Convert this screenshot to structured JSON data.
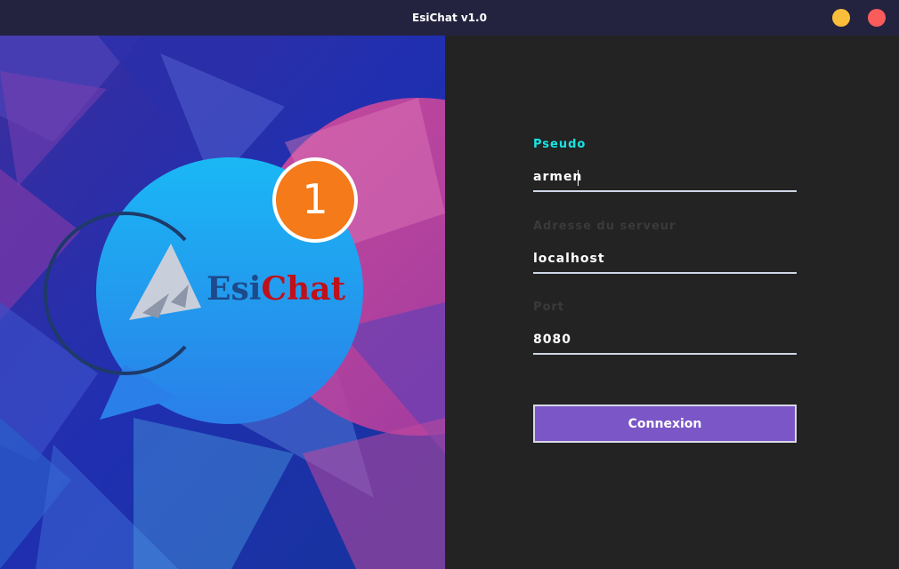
{
  "window": {
    "title": "EsiChat v1.0",
    "minimize_color": "#fbbe3b",
    "close_color": "#fa5c5c"
  },
  "logo": {
    "brand_prefix": "Esi",
    "brand_suffix": "Chat",
    "notification_count": "1"
  },
  "form": {
    "pseudo": {
      "label": "Pseudo",
      "value": "armen"
    },
    "server": {
      "label": "Adresse du serveur",
      "value": "localhost"
    },
    "port": {
      "label": "Port",
      "value": "8080"
    },
    "submit_label": "Connexion"
  },
  "colors": {
    "accent_label": "#18e5e5",
    "button": "#7b56c6",
    "panel": "#232323"
  }
}
